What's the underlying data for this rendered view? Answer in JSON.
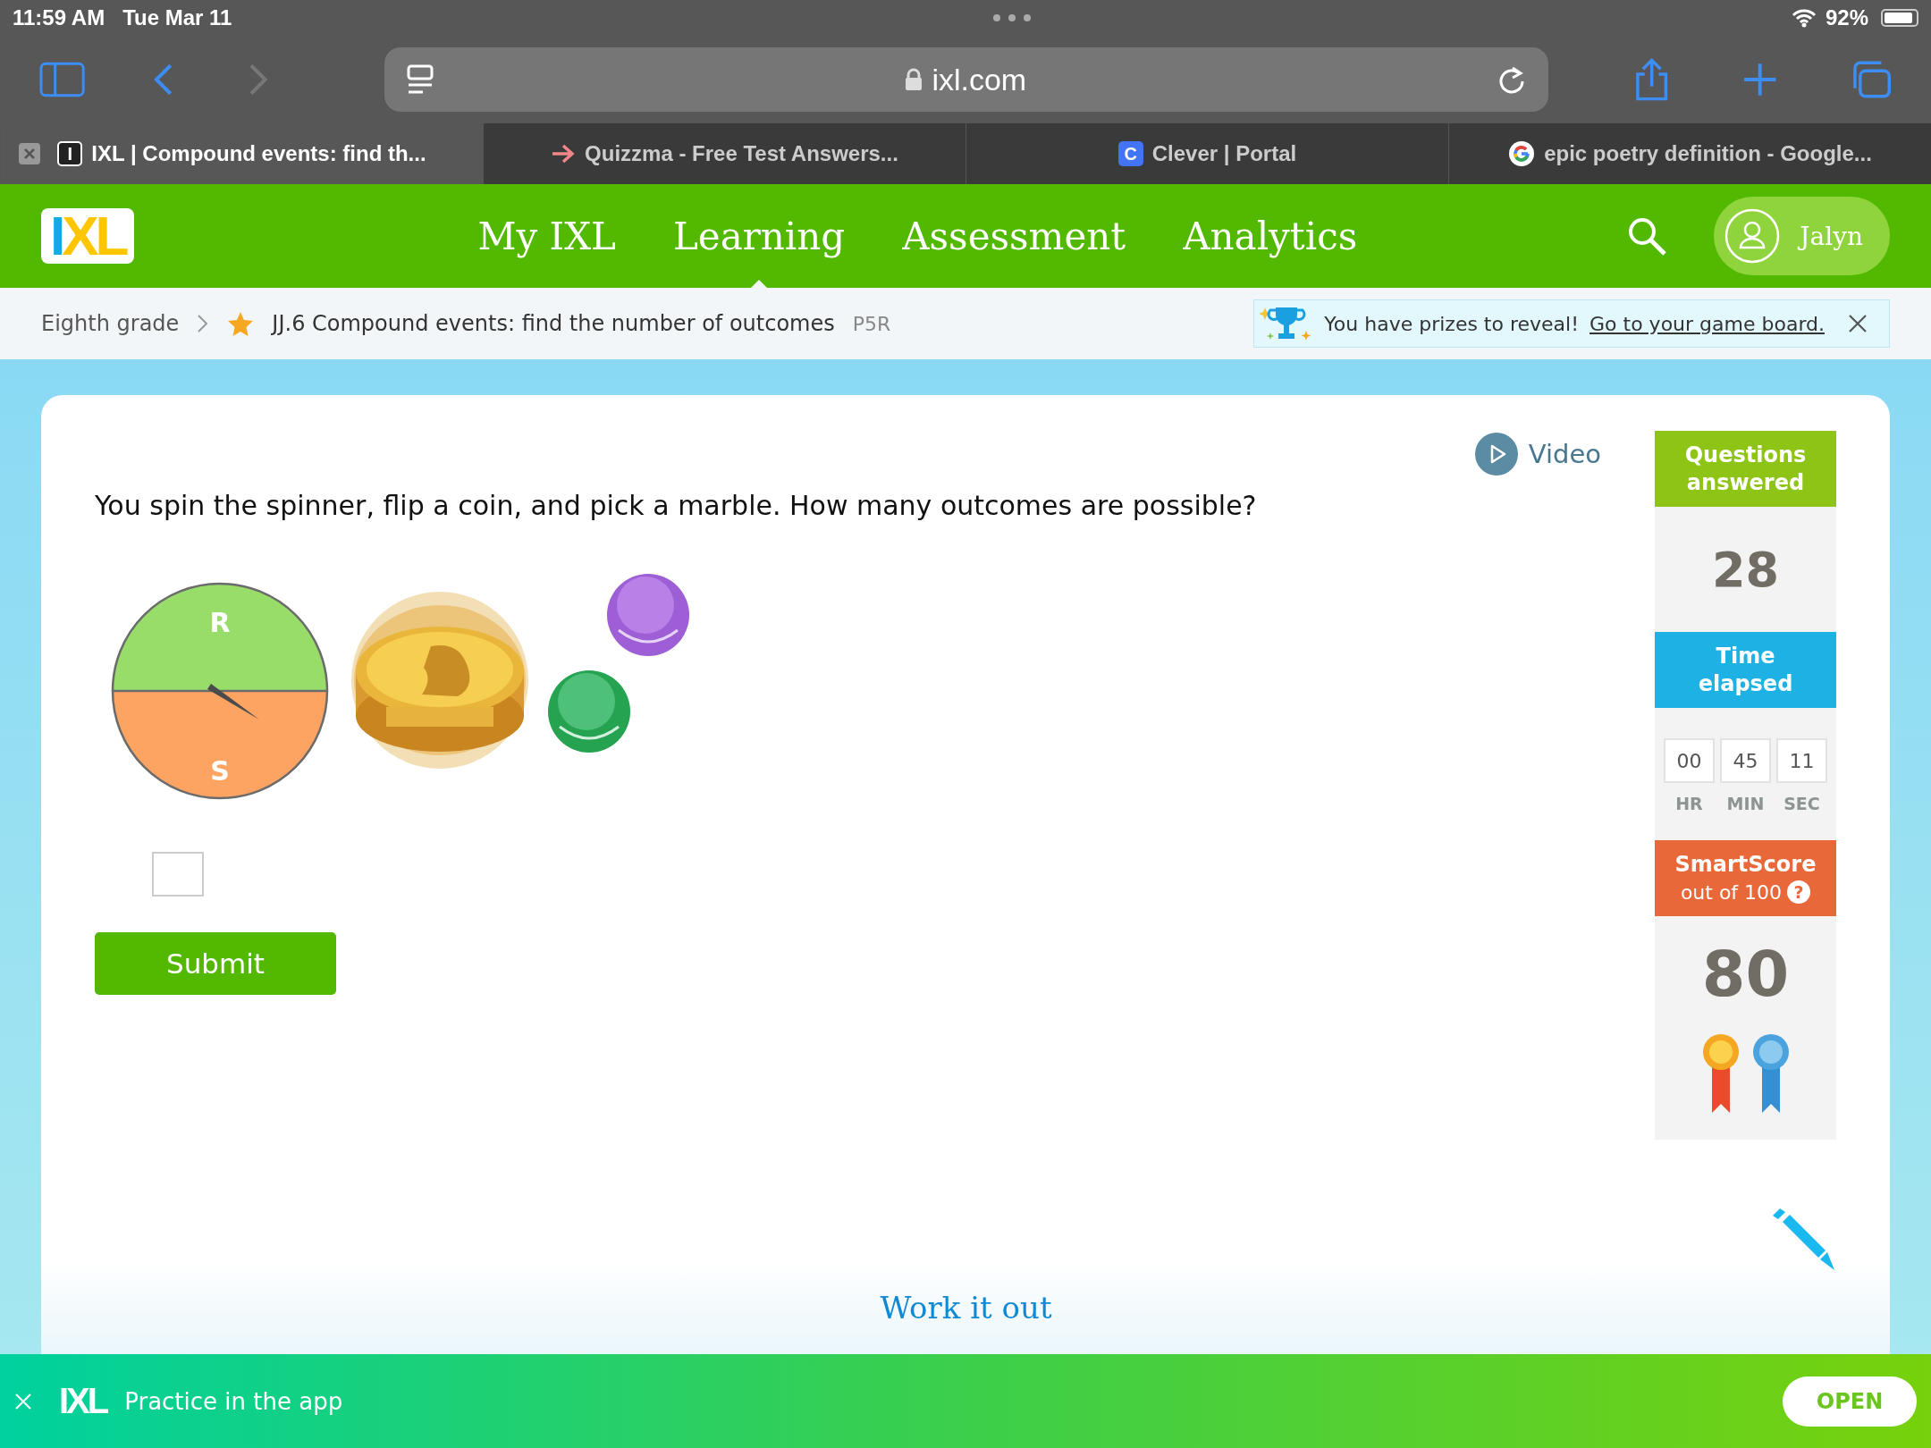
{
  "status_bar": {
    "time": "11:59 AM",
    "date": "Tue Mar 11",
    "battery": "92%"
  },
  "browser": {
    "url": "ixl.com",
    "tabs": [
      {
        "kind": "letter",
        "favicon": "I",
        "title": "IXL | Compound events: find th...",
        "selected": true
      },
      {
        "kind": "arrow",
        "title": "Quizzma - Free Test Answers...",
        "selected": false
      },
      {
        "kind": "letter",
        "favicon": "C",
        "title": "Clever | Portal",
        "selected": false
      },
      {
        "kind": "google",
        "title": "epic poetry definition - Google...",
        "selected": false
      }
    ]
  },
  "header": {
    "logo": "IXL",
    "nav": [
      {
        "label": "My IXL",
        "selected": false
      },
      {
        "label": "Learning",
        "selected": true
      },
      {
        "label": "Assessment",
        "selected": false
      },
      {
        "label": "Analytics",
        "selected": false
      }
    ],
    "user": "Jalyn"
  },
  "breadcrumb": {
    "grade": "Eighth grade",
    "skill": "JJ.6 Compound events: find the number of outcomes",
    "code": "P5R"
  },
  "notice": {
    "text": "You have prizes to reveal!",
    "link": "Go to your game board."
  },
  "question": {
    "video": "Video",
    "text": "You spin the spinner, flip a coin, and pick a marble. How many outcomes are possible?",
    "spinner": [
      "R",
      "S"
    ],
    "submit": "Submit"
  },
  "sidebar": {
    "questions": {
      "title": "Questions answered",
      "value": "28"
    },
    "time": {
      "title": "Time elapsed",
      "parts": [
        {
          "value": "00",
          "unit": "HR"
        },
        {
          "value": "45",
          "unit": "MIN"
        },
        {
          "value": "11",
          "unit": "SEC"
        }
      ]
    },
    "smartscore": {
      "title": "SmartScore",
      "subtitle": "out of 100",
      "help": "?",
      "value": "80"
    }
  },
  "work": {
    "title": "Work it out"
  },
  "app_banner": {
    "logo": "IXL",
    "text": "Practice in the app",
    "button": "OPEN"
  }
}
